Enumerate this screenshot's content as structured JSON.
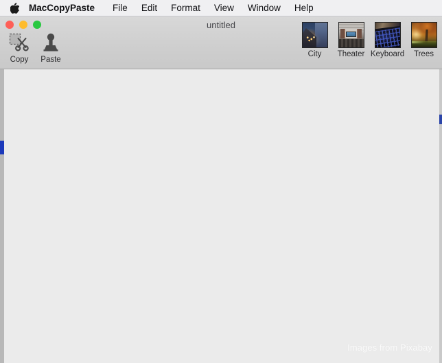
{
  "menubar": {
    "apple_icon": "apple-logo-icon",
    "app_name": "MacCopyPaste",
    "items": [
      {
        "label": "File"
      },
      {
        "label": "Edit"
      },
      {
        "label": "Format"
      },
      {
        "label": "View"
      },
      {
        "label": "Window"
      },
      {
        "label": "Help"
      }
    ]
  },
  "window": {
    "title": "untitled",
    "traffic_lights": {
      "close_color": "#fe5f57",
      "minimize_color": "#febc2e",
      "zoom_color": "#29c840"
    }
  },
  "toolbar": {
    "actions": [
      {
        "label": "Copy",
        "icon": "copy-scissors-icon"
      },
      {
        "label": "Paste",
        "icon": "paste-stamp-icon"
      }
    ],
    "images": [
      {
        "label": "City",
        "icon": "city-thumbnail"
      },
      {
        "label": "Theater",
        "icon": "theater-thumbnail"
      },
      {
        "label": "Keyboard",
        "icon": "keyboard-thumbnail"
      },
      {
        "label": "Trees",
        "icon": "trees-thumbnail"
      }
    ]
  },
  "content": {
    "watermark": "Images from Pixabay",
    "background_color": "#ebebeb",
    "scrollbar_accent": "#1c39bb"
  }
}
